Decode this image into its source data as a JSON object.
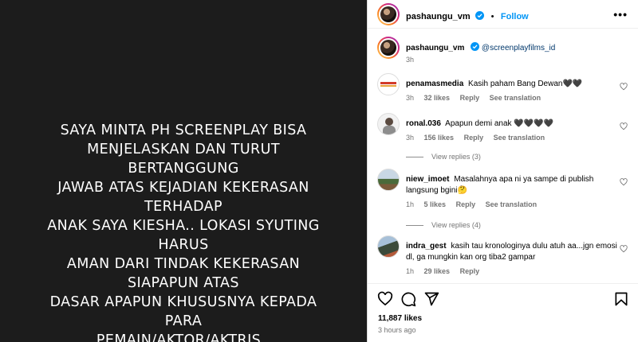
{
  "media": {
    "text": "SAYA MINTA PH SCREENPLAY BISA\nMENJELASKAN DAN TURUT BERTANGGUNG\nJAWAB ATAS KEJADIAN KEKERASAN TERHADAP\nANAK SAYA KIESHA.. LOKASI SYUTING HARUS\nAMAN DARI TINDAK KEKERASAN SIAPAPUN ATAS\nDASAR APAPUN KHUSUSNYA KEPADA PARA\nPEMAIN/AKTOR/AKTRIS.."
  },
  "header": {
    "username": "pashaungu_vm",
    "separator": "•",
    "follow_label": "Follow",
    "more_label": "•••"
  },
  "caption": {
    "username": "pashaungu_vm",
    "mention": "@screenplayfilms_id",
    "time": "3h"
  },
  "comments": [
    {
      "username": "penamasmedia",
      "text": "Kasih paham Bang Dewan🖤🖤",
      "time": "3h",
      "likes": "32 likes",
      "reply": "Reply",
      "translate": "See translation",
      "view_replies": ""
    },
    {
      "username": "ronal.036",
      "text": "Apapun demi anak 🖤🖤🖤🖤",
      "time": "3h",
      "likes": "156 likes",
      "reply": "Reply",
      "translate": "See translation",
      "view_replies": "View replies (3)"
    },
    {
      "username": "niew_imoet",
      "text": "Masalahnya apa ni ya sampe di publish langsung bgini🤔",
      "time": "1h",
      "likes": "5 likes",
      "reply": "Reply",
      "translate": "See translation",
      "view_replies": "View replies (4)"
    },
    {
      "username": "indra_gest",
      "text": "kasih tau kronologinya dulu atuh aa...jgn emosi dl, ga mungkin kan org tiba2 gampar",
      "time": "1h",
      "likes": "29 likes",
      "reply": "Reply",
      "translate": "",
      "view_replies": ""
    }
  ],
  "actions": {
    "like_icon": "heart-icon",
    "comment_icon": "comment-icon",
    "share_icon": "share-icon",
    "save_icon": "bookmark-icon"
  },
  "footer": {
    "likes": "11,887 likes",
    "time_ago": "3 hours ago"
  },
  "colors": {
    "accent": "#0095f6",
    "mention": "#00376b",
    "muted": "#737373",
    "media_bg": "#1c1c1c"
  }
}
